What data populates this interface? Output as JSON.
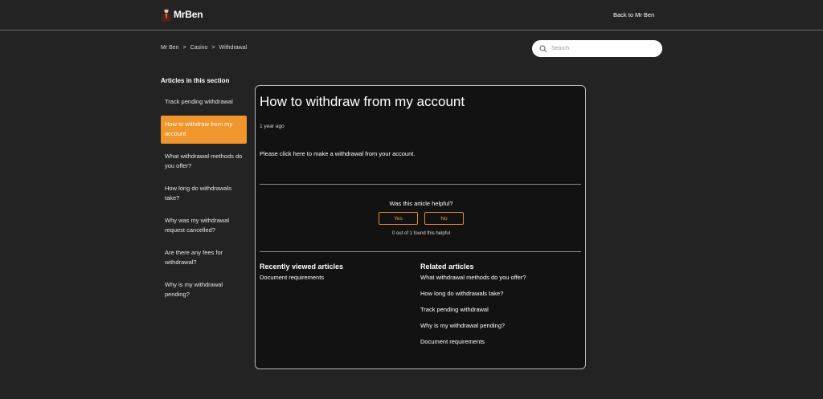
{
  "header": {
    "logo_text": "MrBen",
    "back_link": "Back to Mr Ben"
  },
  "breadcrumb": [
    "Mr Ben",
    "Casino",
    "Withdrawal"
  ],
  "breadcrumb_separator": ">",
  "search": {
    "placeholder": "Search"
  },
  "sidebar": {
    "title": "Articles in this section",
    "items": [
      {
        "label": "Track pending withdrawal",
        "active": false
      },
      {
        "label": "How to withdraw from my account",
        "active": true
      },
      {
        "label": "What withdrawal methods do you offer?",
        "active": false
      },
      {
        "label": "How long do withdrawals take?",
        "active": false
      },
      {
        "label": "Why was my withdrawal request cancelled?",
        "active": false
      },
      {
        "label": "Are there any fees for withdrawal?",
        "active": false
      },
      {
        "label": "Why is my withdrawal pending?",
        "active": false
      }
    ]
  },
  "article": {
    "title": "How to withdraw from my account",
    "meta": "1 year ago",
    "body": "Please click here to make a withdrawal from your account."
  },
  "vote": {
    "question": "Was this article helpful?",
    "yes_label": "Yes",
    "no_label": "No",
    "count_text": "0 out of 1 found this helpful"
  },
  "recently_viewed": {
    "title": "Recently viewed articles",
    "items": [
      "Document requirements"
    ]
  },
  "related": {
    "title": "Related articles",
    "items": [
      "What withdrawal methods do you offer?",
      "How long do withdrawals take?",
      "Track pending withdrawal",
      "Why is my withdrawal pending?",
      "Document requirements"
    ]
  },
  "colors": {
    "background": "#232323",
    "panel": "#121212",
    "accent": "#f0962c"
  }
}
